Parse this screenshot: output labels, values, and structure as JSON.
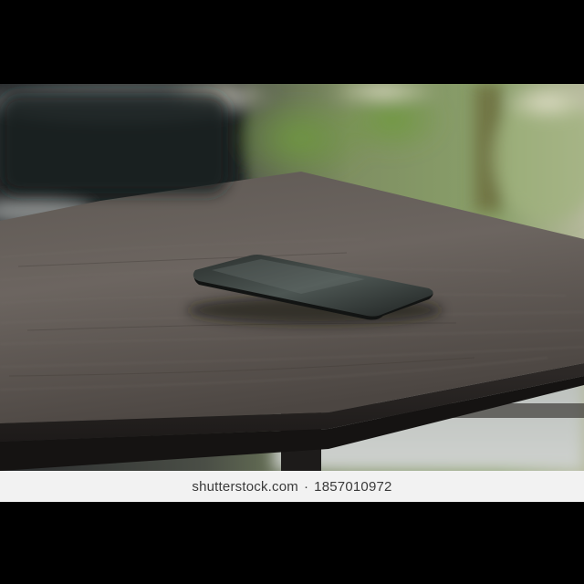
{
  "image": {
    "subject": "smartphone lying face-down on a dark wooden table outdoors",
    "colors": {
      "letterbox": "#000000",
      "table_wood": "#4b4542",
      "table_wood_light": "#6c6661",
      "phone_body": "#1c1f1e",
      "phone_glare": "#4a5350",
      "foliage": "#6f8a4a",
      "bokeh_light": "#d9d6c6"
    }
  },
  "watermark": {
    "site": "shutterstock.com",
    "separator": "·",
    "image_id": "1857010972"
  }
}
